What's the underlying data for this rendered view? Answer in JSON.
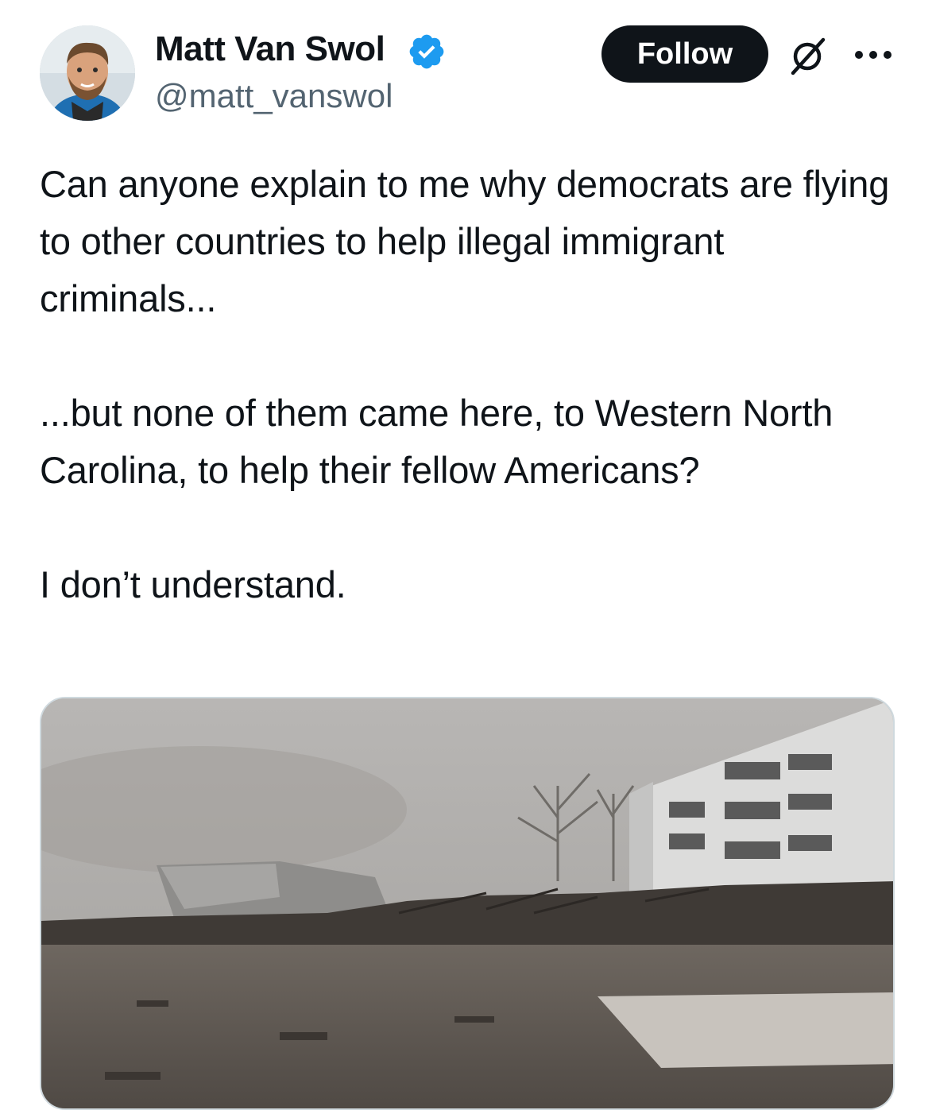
{
  "author": {
    "display_name": "Matt Van Swol",
    "handle": "@matt_vanswol",
    "verified": true,
    "verified_color": "#1d9bf0"
  },
  "actions": {
    "follow_label": "Follow",
    "grok_icon": "grok-icon",
    "more_icon": "more-icon"
  },
  "tweet": {
    "paragraph_1": "Can anyone explain to me why democrats are flying to other countries to help illegal immigrant criminals...",
    "paragraph_2": "...but none of them came here, to Western North Carolina, to help their fellow Americans?",
    "paragraph_3": "I don’t understand."
  },
  "media": {
    "type": "photo",
    "subject": "storm-damaged-site"
  },
  "colors": {
    "text_primary": "#0f1419",
    "text_secondary": "#536471",
    "button_bg": "#0f1419",
    "border": "#cfd9de"
  }
}
